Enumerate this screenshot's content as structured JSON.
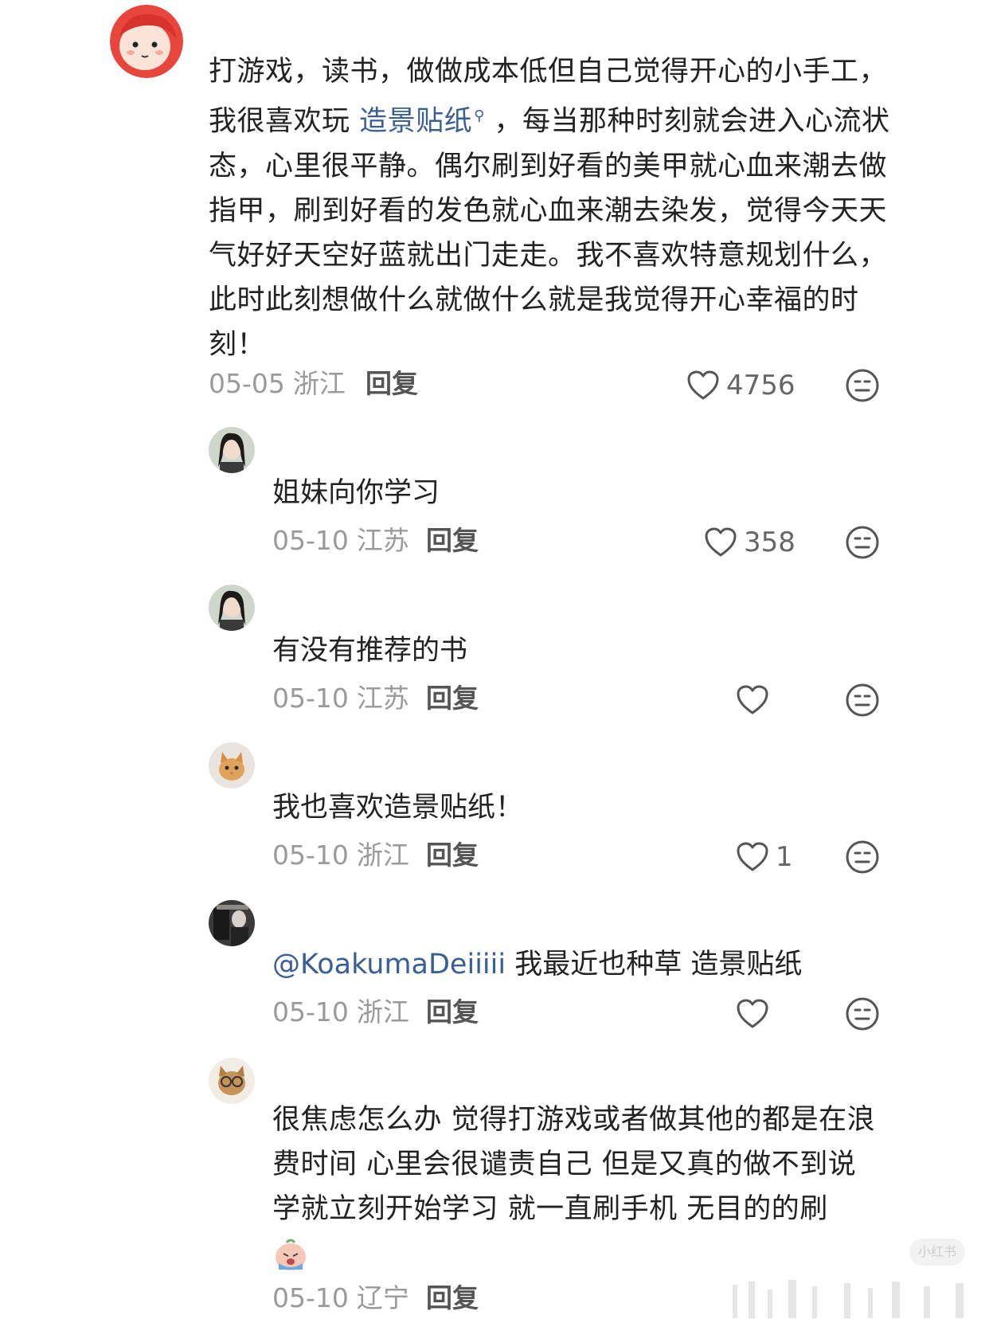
{
  "main_comment": {
    "text_before": "打游戏，读书，做做成本低但自己觉得开心的小手工，我很喜欢玩 ",
    "link_text": "造景贴纸",
    "link_icon": "search-icon",
    "text_after": " ，每当那种时刻就会进入心流状态，心里很平静。偶尔刷到好看的美甲就心血来潮去做指甲，刷到好看的发色就心血来潮去染发，觉得今天天气好好天空好蓝就出门走走。我不喜欢特意规划什么，此时此刻想做什么就做什么就是我觉得开心幸福的时刻！",
    "date": "05-05",
    "location": "浙江",
    "reply_label": "回复",
    "like_count": "4756"
  },
  "replies": [
    {
      "text": "姐妹向你学习",
      "date": "05-10",
      "location": "江苏",
      "reply_label": "回复",
      "like_count": "358"
    },
    {
      "text": "有没有推荐的书",
      "date": "05-10",
      "location": "江苏",
      "reply_label": "回复",
      "like_count": ""
    },
    {
      "text": "我也喜欢造景贴纸！",
      "date": "05-10",
      "location": "浙江",
      "reply_label": "回复",
      "like_count": "1"
    },
    {
      "mention": "@KoakumaDeiiiii",
      "text": " 我最近也种草 造景贴纸",
      "date": "05-10",
      "location": "浙江",
      "reply_label": "回复",
      "like_count": ""
    },
    {
      "text": "很焦虑怎么办 觉得打游戏或者做其他的都是在浪费时间 心里会很谴责自己 但是又真的做不到说学就立刻开始学习 就一直刷手机 无目的的刷",
      "emoji": "crying-emoji",
      "date": "05-10",
      "location": "辽宁",
      "reply_label": "回复"
    }
  ],
  "watermark": "小红书",
  "colors": {
    "link": "#3a5f95",
    "meta": "#9a9a9a",
    "text": "#222222"
  }
}
